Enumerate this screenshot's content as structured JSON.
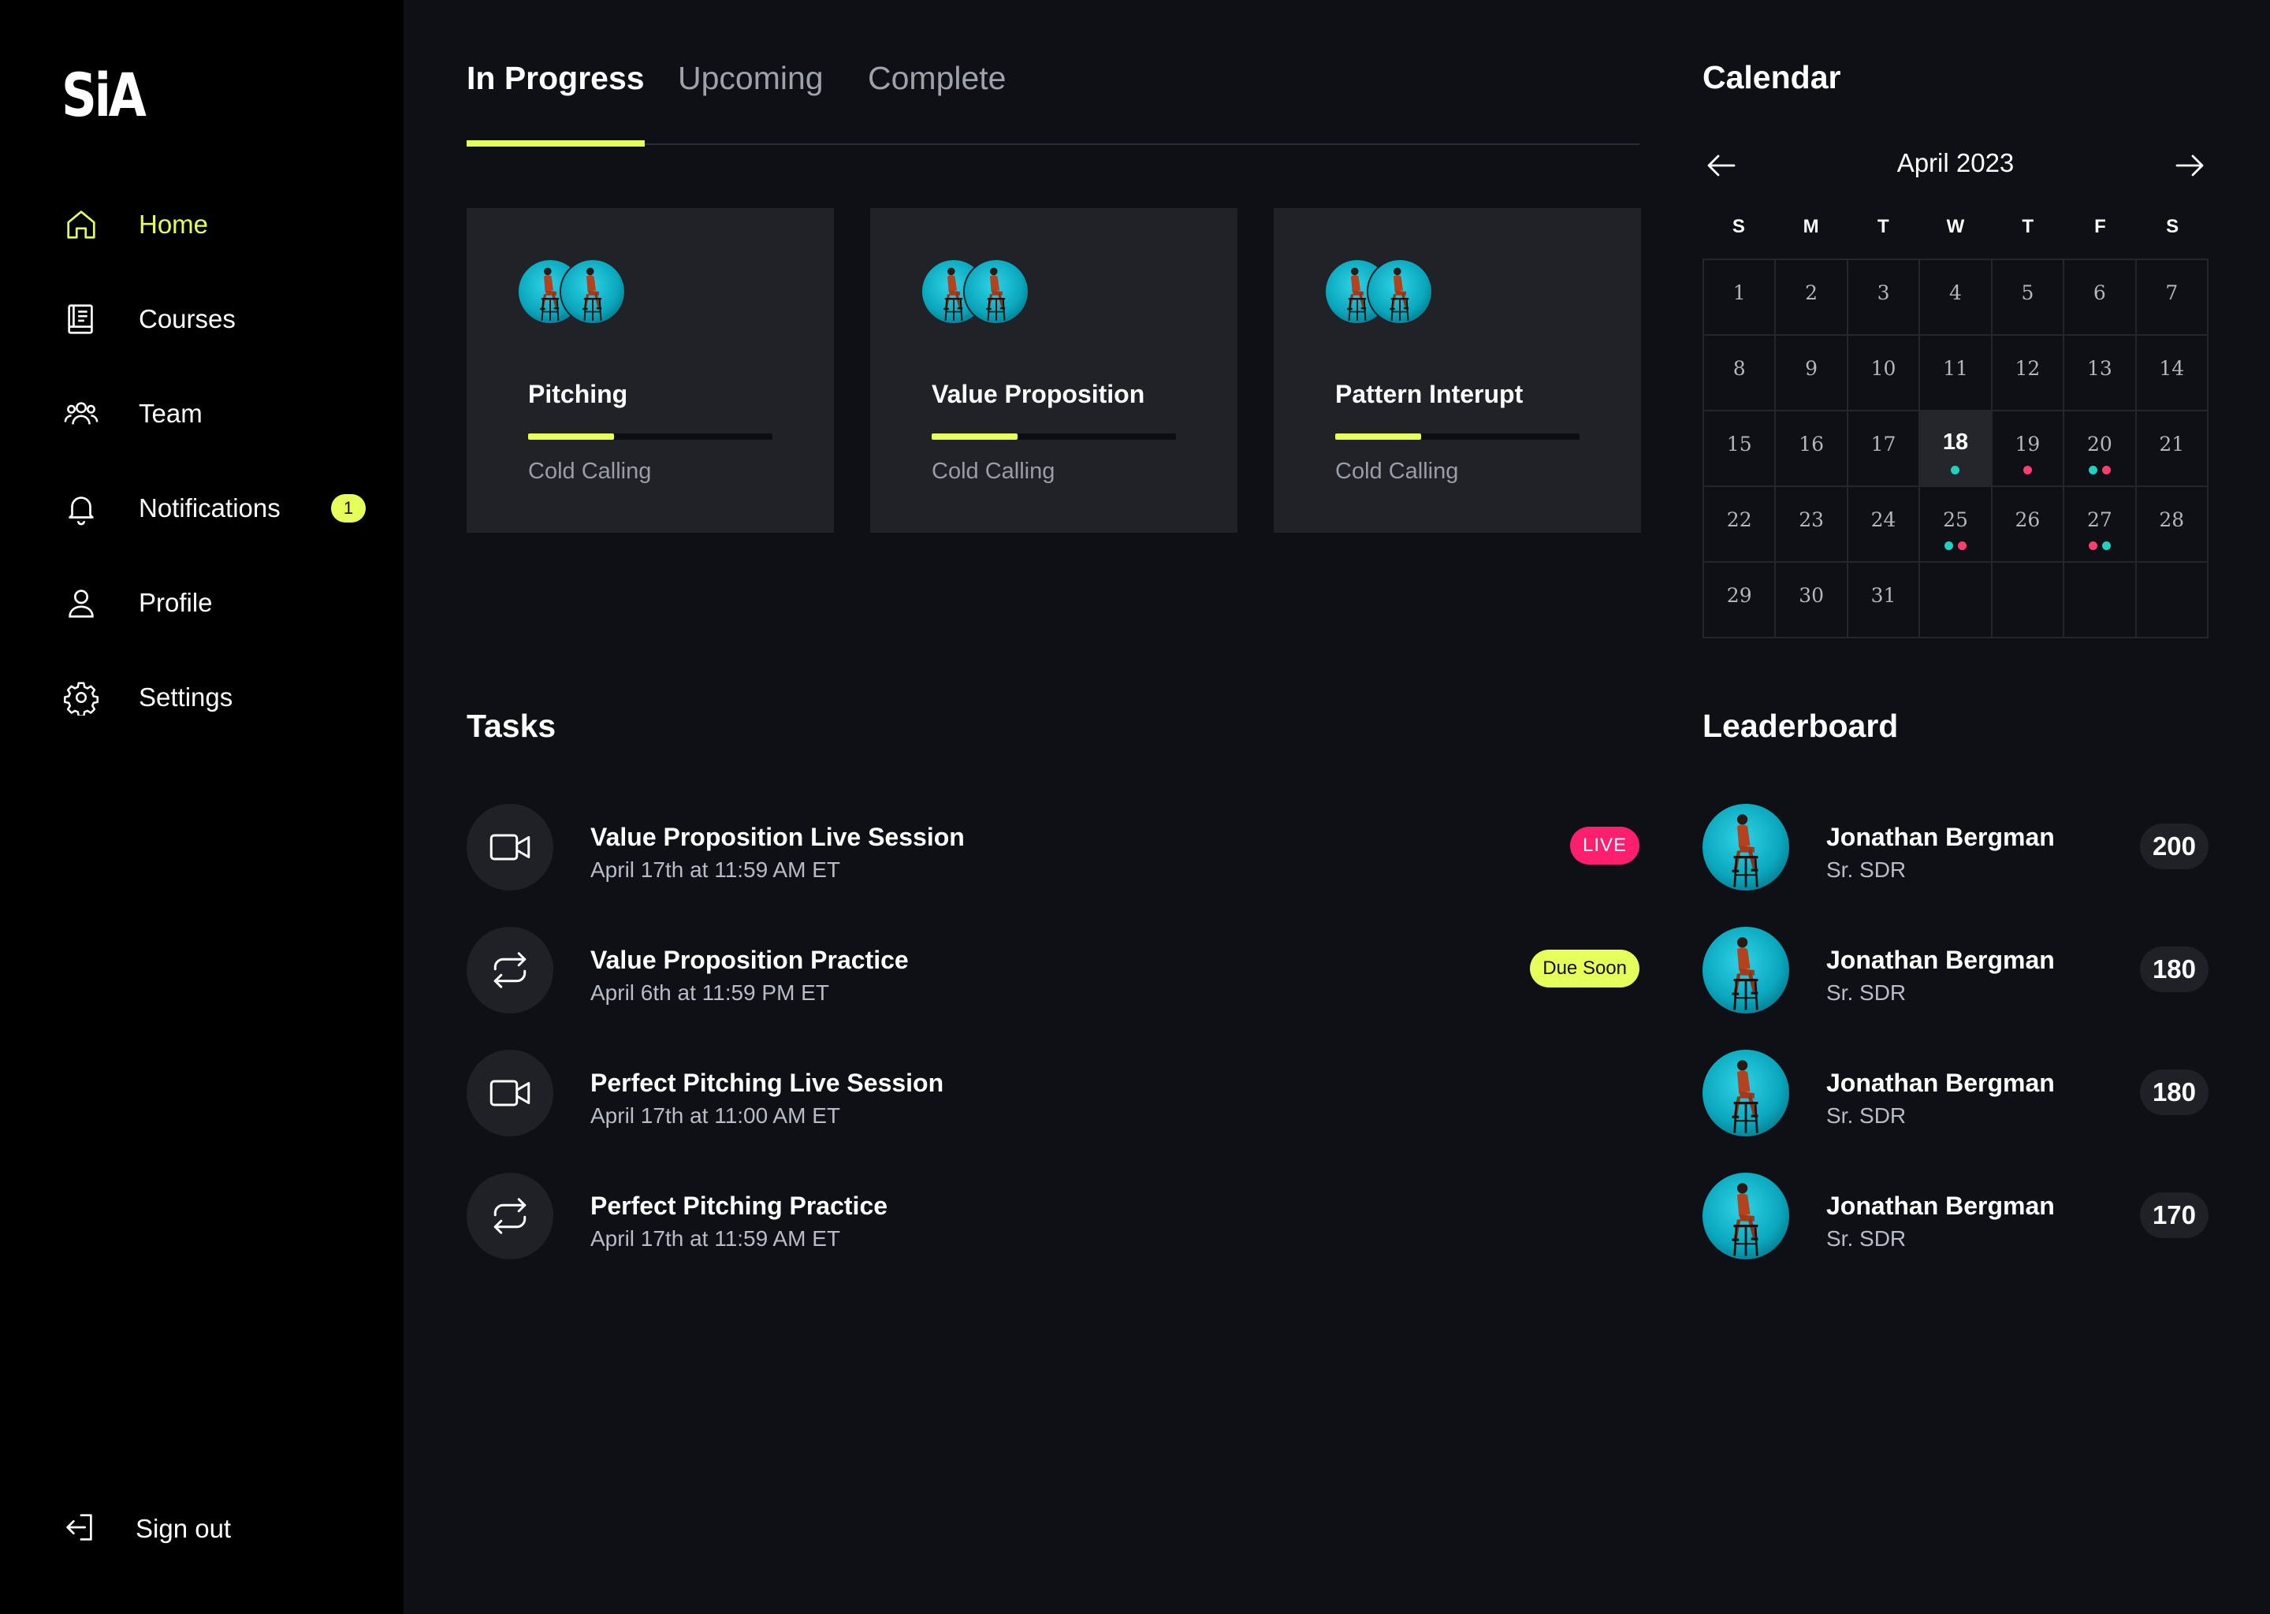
{
  "app": {
    "logo": "SiA"
  },
  "sidebar": {
    "items": [
      {
        "label": "Home",
        "icon": "home-icon"
      },
      {
        "label": "Courses",
        "icon": "book-icon"
      },
      {
        "label": "Team",
        "icon": "team-icon"
      },
      {
        "label": "Notifications",
        "icon": "bell-icon",
        "badge": "1"
      },
      {
        "label": "Profile",
        "icon": "user-icon"
      },
      {
        "label": "Settings",
        "icon": "gear-icon"
      }
    ],
    "signout": {
      "label": "Sign out",
      "icon": "sign-out-icon"
    }
  },
  "tabs": [
    {
      "label": "In Progress",
      "active": true
    },
    {
      "label": "Upcoming",
      "active": false
    },
    {
      "label": "Complete",
      "active": false
    }
  ],
  "courses": [
    {
      "title": "Pitching",
      "subtitle": "Cold Calling",
      "progress": 0.35
    },
    {
      "title": "Value Proposition",
      "subtitle": "Cold Calling",
      "progress": 0.35
    },
    {
      "title": "Pattern Interupt",
      "subtitle": "Cold Calling",
      "progress": 0.35
    }
  ],
  "tasks": {
    "title": "Tasks",
    "items": [
      {
        "title": "Value Proposition Live Session",
        "time": "April 17th at 11:59 AM ET",
        "icon": "video-camera-icon",
        "badge": "LIVE"
      },
      {
        "title": "Value Proposition Practice",
        "time": "April 6th at 11:59 PM ET",
        "icon": "repeat-icon",
        "badge": "Due Soon"
      },
      {
        "title": "Perfect Pitching Live Session",
        "time": "April 17th at 11:00 AM ET",
        "icon": "video-camera-icon",
        "badge": ""
      },
      {
        "title": "Perfect Pitching Practice",
        "time": "April 17th at 11:59 AM ET",
        "icon": "repeat-icon",
        "badge": ""
      }
    ]
  },
  "calendar": {
    "title": "Calendar",
    "month": "April 2023",
    "weekdays": [
      "S",
      "M",
      "T",
      "W",
      "T",
      "F",
      "S"
    ],
    "days": [
      "1",
      "2",
      "3",
      "4",
      "5",
      "6",
      "7",
      "8",
      "9",
      "10",
      "11",
      "12",
      "13",
      "14",
      "15",
      "16",
      "17",
      "18",
      "19",
      "20",
      "21",
      "22",
      "23",
      "24",
      "25",
      "26",
      "27",
      "28",
      "29",
      "30",
      "31"
    ],
    "today": "18",
    "events": {
      "18": [
        "#1fd1c1"
      ],
      "19": [
        "#ff3d6e"
      ],
      "20": [
        "#1fd1c1",
        "#ff3d6e"
      ],
      "25": [
        "#1fd1c1",
        "#ff3d6e"
      ],
      "27": [
        "#ff3d6e",
        "#1fd1c1"
      ]
    }
  },
  "leaderboard": {
    "title": "Leaderboard",
    "items": [
      {
        "name": "Jonathan Bergman",
        "role": "Sr. SDR",
        "score": "200"
      },
      {
        "name": "Jonathan Bergman",
        "role": "Sr. SDR",
        "score": "180"
      },
      {
        "name": "Jonathan Bergman",
        "role": "Sr. SDR",
        "score": "180"
      },
      {
        "name": "Jonathan Bergman",
        "role": "Sr. SDR",
        "score": "170"
      }
    ]
  },
  "colors": {
    "accent": "#e6ff5a",
    "live": "#ff1f6e",
    "event_teal": "#1fd1c1",
    "event_pink": "#ff3d6e"
  }
}
